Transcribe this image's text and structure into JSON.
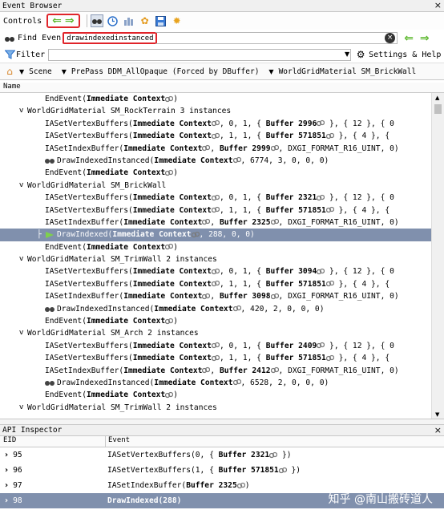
{
  "event_browser": {
    "title": "Event Browser",
    "controls_label": "Controls",
    "find_label": "Find Even",
    "find_value": "drawindexedinstanced",
    "filter_label": "Filter",
    "settings_label": "Settings & Help",
    "breadcrumb": [
      "Scene",
      "PrePass DDM_AllOpaque (Forced by DBuffer)",
      "WorldGridMaterial SM_BrickWall"
    ],
    "column_name": "Name"
  },
  "tree_rows": [
    {
      "indent": 56,
      "text": "EndEvent(",
      "bold": "Immediate Context",
      "tail": ")",
      "icon": true
    },
    {
      "indent": 34,
      "chev": "v",
      "text": "WorldGridMaterial SM_RockTerrain 3 instances"
    },
    {
      "indent": 56,
      "text": "IASetVertexBuffers(",
      "bold": "Immediate Context",
      "tail": ",  0,  1,  {  ",
      "bold2": "Buffer 2996",
      "tail2": "  },  {  12  },  {  0"
    },
    {
      "indent": 56,
      "text": "IASetVertexBuffers(",
      "bold": "Immediate Context",
      "tail": ",  1,  1,  {  ",
      "bold2": "Buffer 571851",
      "tail2": "  },  {  4  },  {"
    },
    {
      "indent": 56,
      "text": "IASetIndexBuffer(",
      "bold": "Immediate Context",
      "tail": ",  ",
      "bold2": "Buffer 2999",
      "tail2": ",  DXGI_FORMAT_R16_UINT,  0)"
    },
    {
      "indent": 56,
      "draw": true,
      "text": "DrawIndexedInstanced(",
      "bold": "Immediate Context",
      "tail": ",  6774,  3,  0,  0,  0)"
    },
    {
      "indent": 56,
      "text": "EndEvent(",
      "bold": "Immediate Context",
      "tail": ")",
      "icon": true
    },
    {
      "indent": 34,
      "chev": "v",
      "text": "WorldGridMaterial SM_BrickWall"
    },
    {
      "indent": 56,
      "text": "IASetVertexBuffers(",
      "bold": "Immediate Context",
      "tail": ",  0,  1,  {  ",
      "bold2": "Buffer 2321",
      "tail2": "  },  {  12  },  {  0"
    },
    {
      "indent": 56,
      "text": "IASetVertexBuffers(",
      "bold": "Immediate Context",
      "tail": ",  1,  1,  {  ",
      "bold2": "Buffer 571851",
      "tail2": "  },  {  4  },  {"
    },
    {
      "indent": 56,
      "text": "IASetIndexBuffer(",
      "bold": "Immediate Context",
      "tail": ",  ",
      "bold2": "Buffer 2325",
      "tail2": ",  DXGI_FORMAT_R16_UINT,  0)"
    },
    {
      "indent": 56,
      "selected": true,
      "flag": true,
      "text": "DrawIndexed(",
      "bold": "Immediate Context",
      "tail": ",  288,  0,  0)"
    },
    {
      "indent": 56,
      "text": "EndEvent(",
      "bold": "Immediate Context",
      "tail": ")",
      "icon": true
    },
    {
      "indent": 34,
      "chev": "v",
      "text": "WorldGridMaterial SM_TrimWall 2 instances"
    },
    {
      "indent": 56,
      "text": "IASetVertexBuffers(",
      "bold": "Immediate Context",
      "tail": ",  0,  1,  {  ",
      "bold2": "Buffer 3094",
      "tail2": "  },  {  12  },  {  0"
    },
    {
      "indent": 56,
      "text": "IASetVertexBuffers(",
      "bold": "Immediate Context",
      "tail": ",  1,  1,  {  ",
      "bold2": "Buffer 571851",
      "tail2": "  },  {  4  },  {"
    },
    {
      "indent": 56,
      "text": "IASetIndexBuffer(",
      "bold": "Immediate Context",
      "tail": ",  ",
      "bold2": "Buffer 3098",
      "tail2": ",  DXGI_FORMAT_R16_UINT,  0)"
    },
    {
      "indent": 56,
      "draw": true,
      "text": "DrawIndexedInstanced(",
      "bold": "Immediate Context",
      "tail": ",  420,  2,  0,  0,  0)"
    },
    {
      "indent": 56,
      "text": "EndEvent(",
      "bold": "Immediate Context",
      "tail": ")",
      "icon": true
    },
    {
      "indent": 34,
      "chev": "v",
      "text": "WorldGridMaterial SM_Arch 2 instances"
    },
    {
      "indent": 56,
      "text": "IASetVertexBuffers(",
      "bold": "Immediate Context",
      "tail": ",  0,  1,  {  ",
      "bold2": "Buffer 2409",
      "tail2": "  },  {  12  },  {  0"
    },
    {
      "indent": 56,
      "text": "IASetVertexBuffers(",
      "bold": "Immediate Context",
      "tail": ",  1,  1,  {  ",
      "bold2": "Buffer 571851",
      "tail2": "  },  {  4  },  {"
    },
    {
      "indent": 56,
      "text": "IASetIndexBuffer(",
      "bold": "Immediate Context",
      "tail": ",  ",
      "bold2": "Buffer 2412",
      "tail2": ",  DXGI_FORMAT_R16_UINT,  0)"
    },
    {
      "indent": 56,
      "draw": true,
      "text": "DrawIndexedInstanced(",
      "bold": "Immediate Context",
      "tail": ",  6528,  2,  0,  0,  0)"
    },
    {
      "indent": 56,
      "text": "EndEvent(",
      "bold": "Immediate Context",
      "tail": ")",
      "icon": true
    },
    {
      "indent": 34,
      "chev": "v",
      "text": "WorldGridMaterial SM_TrimWall 2 instances"
    }
  ],
  "api_inspector": {
    "title": "API Inspector",
    "col_eid": "EID",
    "col_event": "Event",
    "rows": [
      {
        "eid": "95",
        "pre": "IASetVertexBuffers(0,  {  ",
        "bold": "Buffer 2321",
        "post": "  })"
      },
      {
        "eid": "96",
        "pre": "IASetVertexBuffers(1,  {  ",
        "bold": "Buffer 571851",
        "post": "  })"
      },
      {
        "eid": "97",
        "pre": "IASetIndexBuffer(",
        "bold": "Buffer 2325",
        "post": ")"
      },
      {
        "eid": "98",
        "pre": "",
        "bold": "DrawIndexed(288)",
        "post": "",
        "selected": true
      }
    ]
  },
  "watermark": "知乎 @南山搬砖道人",
  "colors": {
    "selection": "#8090ad",
    "highlight_border": "#e0242a",
    "arrow_green": "#5cb82e"
  }
}
